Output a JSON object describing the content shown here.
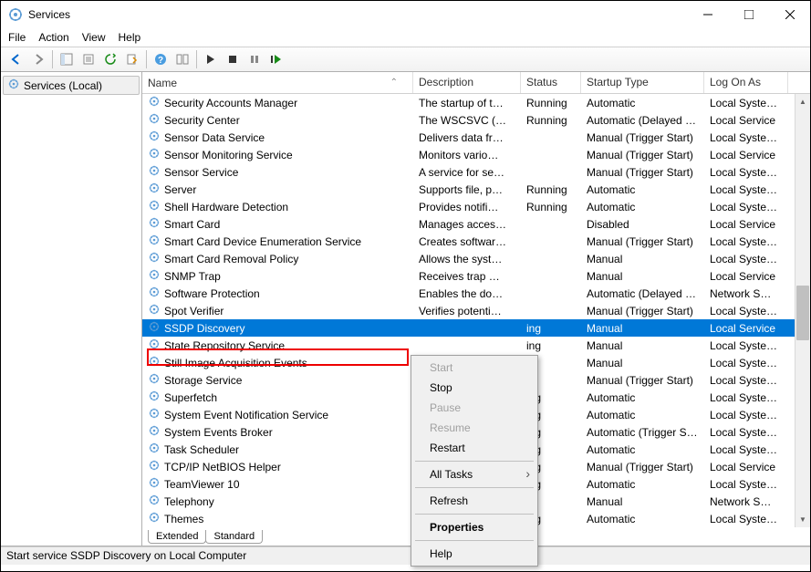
{
  "window": {
    "title": "Services"
  },
  "menus": [
    "File",
    "Action",
    "View",
    "Help"
  ],
  "tree": {
    "root": "Services (Local)"
  },
  "columns": {
    "name": "Name",
    "description": "Description",
    "status": "Status",
    "startup": "Startup Type",
    "logon": "Log On As"
  },
  "services": [
    {
      "name": "Security Accounts Manager",
      "desc": "The startup of t…",
      "status": "Running",
      "startup": "Automatic",
      "logon": "Local Syste…"
    },
    {
      "name": "Security Center",
      "desc": "The WSCSVC (…",
      "status": "Running",
      "startup": "Automatic (Delayed …",
      "logon": "Local Service"
    },
    {
      "name": "Sensor Data Service",
      "desc": "Delivers data fr…",
      "status": "",
      "startup": "Manual (Trigger Start)",
      "logon": "Local Syste…"
    },
    {
      "name": "Sensor Monitoring Service",
      "desc": "Monitors vario…",
      "status": "",
      "startup": "Manual (Trigger Start)",
      "logon": "Local Service"
    },
    {
      "name": "Sensor Service",
      "desc": "A service for se…",
      "status": "",
      "startup": "Manual (Trigger Start)",
      "logon": "Local Syste…"
    },
    {
      "name": "Server",
      "desc": "Supports file, p…",
      "status": "Running",
      "startup": "Automatic",
      "logon": "Local Syste…"
    },
    {
      "name": "Shell Hardware Detection",
      "desc": "Provides notifi…",
      "status": "Running",
      "startup": "Automatic",
      "logon": "Local Syste…"
    },
    {
      "name": "Smart Card",
      "desc": "Manages acces…",
      "status": "",
      "startup": "Disabled",
      "logon": "Local Service"
    },
    {
      "name": "Smart Card Device Enumeration Service",
      "desc": "Creates softwar…",
      "status": "",
      "startup": "Manual (Trigger Start)",
      "logon": "Local Syste…"
    },
    {
      "name": "Smart Card Removal Policy",
      "desc": "Allows the syst…",
      "status": "",
      "startup": "Manual",
      "logon": "Local Syste…"
    },
    {
      "name": "SNMP Trap",
      "desc": "Receives trap …",
      "status": "",
      "startup": "Manual",
      "logon": "Local Service"
    },
    {
      "name": "Software Protection",
      "desc": "Enables the do…",
      "status": "",
      "startup": "Automatic (Delayed …",
      "logon": "Network S…"
    },
    {
      "name": "Spot Verifier",
      "desc": "Verifies potenti…",
      "status": "",
      "startup": "Manual (Trigger Start)",
      "logon": "Local Syste…"
    },
    {
      "name": "SSDP Discovery",
      "desc": "",
      "status": "ing",
      "startup": "Manual",
      "logon": "Local Service",
      "selected": true
    },
    {
      "name": "State Repository Service",
      "desc": "",
      "status": "ing",
      "startup": "Manual",
      "logon": "Local Syste…"
    },
    {
      "name": "Still Image Acquisition Events",
      "desc": "",
      "status": "",
      "startup": "Manual",
      "logon": "Local Syste…"
    },
    {
      "name": "Storage Service",
      "desc": "",
      "status": "",
      "startup": "Manual (Trigger Start)",
      "logon": "Local Syste…"
    },
    {
      "name": "Superfetch",
      "desc": "",
      "status": "ing",
      "startup": "Automatic",
      "logon": "Local Syste…"
    },
    {
      "name": "System Event Notification Service",
      "desc": "",
      "status": "ing",
      "startup": "Automatic",
      "logon": "Local Syste…"
    },
    {
      "name": "System Events Broker",
      "desc": "",
      "status": "ing",
      "startup": "Automatic (Trigger S…",
      "logon": "Local Syste…"
    },
    {
      "name": "Task Scheduler",
      "desc": "",
      "status": "ing",
      "startup": "Automatic",
      "logon": "Local Syste…"
    },
    {
      "name": "TCP/IP NetBIOS Helper",
      "desc": "",
      "status": "ing",
      "startup": "Manual (Trigger Start)",
      "logon": "Local Service"
    },
    {
      "name": "TeamViewer 10",
      "desc": "",
      "status": "ing",
      "startup": "Automatic",
      "logon": "Local Syste…"
    },
    {
      "name": "Telephony",
      "desc": "",
      "status": "",
      "startup": "Manual",
      "logon": "Network S…"
    },
    {
      "name": "Themes",
      "desc": "",
      "status": "ing",
      "startup": "Automatic",
      "logon": "Local Syste…"
    }
  ],
  "context_menu": {
    "start": "Start",
    "stop": "Stop",
    "pause": "Pause",
    "resume": "Resume",
    "restart": "Restart",
    "all_tasks": "All Tasks",
    "refresh": "Refresh",
    "properties": "Properties",
    "help": "Help"
  },
  "tabs": {
    "extended": "Extended",
    "standard": "Standard"
  },
  "status_bar": "Start service SSDP Discovery on Local Computer"
}
